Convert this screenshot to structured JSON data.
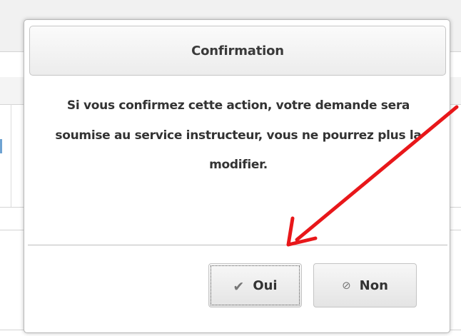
{
  "dialog": {
    "title": "Confirmation",
    "message": "Si vous confirmez cette action, votre demande sera soumise au service instructeur, vous ne pourrez plus la modifier.",
    "buttons": {
      "confirm": {
        "label": "Oui",
        "icon": "check-icon"
      },
      "cancel": {
        "label": "Non",
        "icon": "cancel-icon"
      }
    }
  },
  "annotation": {
    "type": "arrow",
    "color": "#e8171a",
    "points_to": "confirm-button"
  }
}
